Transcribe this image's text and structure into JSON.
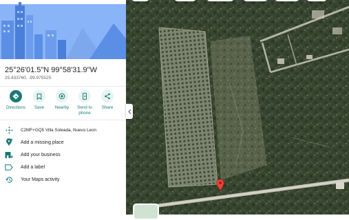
{
  "place": {
    "coordinates_dms": "25°26'01.5\"N 99°58'31.9\"W",
    "coordinates_decimal": "25.433760, -99.975525"
  },
  "actions": [
    {
      "label": "Directions",
      "icon": "directions-icon"
    },
    {
      "label": "Save",
      "icon": "bookmark-icon"
    },
    {
      "label": "Nearby",
      "icon": "nearby-icon"
    },
    {
      "label": "Send to phone",
      "icon": "phone-icon"
    },
    {
      "label": "Share",
      "icon": "share-icon"
    }
  ],
  "details": [
    {
      "text": "C2MF+GQ5 Villa Soleada, Nuevo Leon",
      "icon": "plus-code-icon"
    },
    {
      "text": "Add a missing place",
      "icon": "add-place-icon"
    },
    {
      "text": "Add your business",
      "icon": "business-icon"
    },
    {
      "text": "Add a label",
      "icon": "label-icon"
    },
    {
      "text": "Your Maps activity",
      "icon": "history-icon"
    }
  ],
  "colors": {
    "accent": "#1a7a74",
    "marker": "#ea4335",
    "hero_sky": "#8ab4f8"
  }
}
